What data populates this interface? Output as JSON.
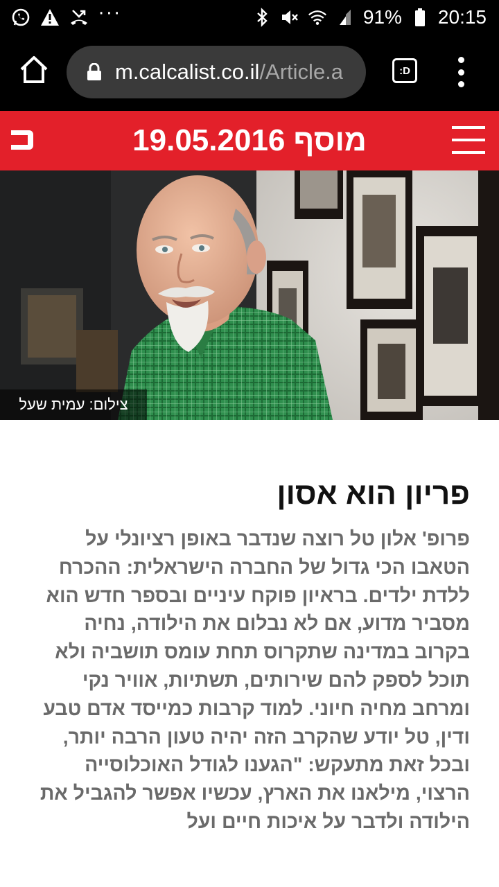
{
  "status_bar": {
    "left_icons": [
      "whatsapp-icon",
      "warning-icon",
      "missed-call-icon",
      "more-notifications-icon"
    ],
    "more_dots": "···",
    "right_icons": [
      "bluetooth-icon",
      "mute-icon",
      "wifi-icon",
      "signal-icon"
    ],
    "battery_percent": "91%",
    "time": "20:15"
  },
  "browser": {
    "url_domain": "m.calcalist.co.il",
    "url_path": "/Article.a",
    "tab_switcher_label": ":D"
  },
  "site_header": {
    "logo_text": "כ",
    "title": "מוסף 19.05.2016",
    "brand_color": "#e3202a"
  },
  "hero": {
    "photo_credit": "צילום: עמית שעל"
  },
  "article": {
    "headline": "פריון הוא אסון",
    "lead": "פרופ' אלון טל רוצה שנדבר באופן רציונלי על הטאבו הכי גדול של החברה הישראלית: ההכרח ללדת ילדים. בראיון פוקח עיניים ובספר חדש הוא מסביר מדוע, אם לא נבלום את הילודה, נחיה בקרוב במדינה שתקרוס תחת עומס תושביה ולא תוכל לספק להם שירותים, תשתיות, אוויר נקי ומרחב מחיה חיוני. למוד קרבות כמייסד אדם טבע ודין, טל יודע שהקרב הזה יהיה טעון הרבה יותר, ובכל זאת מתעקש: \"הגענו לגודל האוכלוסייה הרצוי, מילאנו את הארץ, עכשיו אפשר להגביל את הילודה ולדבר על איכות חיים ועל"
  }
}
